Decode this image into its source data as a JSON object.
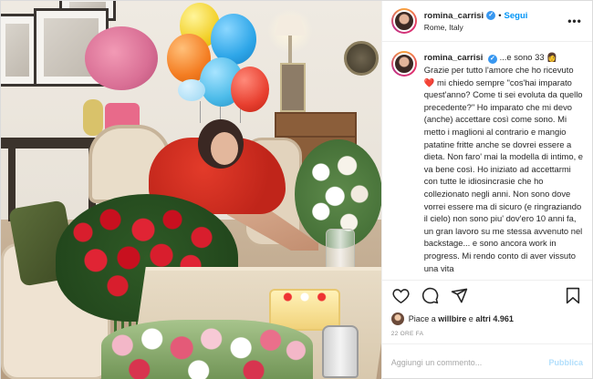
{
  "header": {
    "username": "romina_carrisi",
    "separator": "•",
    "follow_label": "Segui",
    "location": "Rome, Italy",
    "more_label": "•••"
  },
  "caption": {
    "username": "romina_carrisi",
    "title_line": "...e sono 33",
    "body_1": "Grazie per tutto l'amore che ho ricevuto",
    "body_2": " mi chiedo sempre \"cos'hai imparato quest'anno? Come ti sei evoluta da quello precedente?\" Ho imparato che mi devo (anche) accettare così come sono. Mi metto i maglioni al contrario e mangio patatine fritte anche se dovrei essere a dieta. Non faro' mai la modella di intimo, e va bene così. Ho iniziato ad accettarmi con tutte le idiosincrasie che ho collezionato negli anni. Non sono dove vorrei essere ma di sicuro (e ringraziando il cielo) non sono piu' dov'ero 10 anni fa, un gran lavoro su me stessa avvenuto nel backstage... e sono ancora work in progress. Mi rendo conto di aver vissuto una vita"
  },
  "likes": {
    "prefix": "Piace a",
    "user": "willbire",
    "middle": "e",
    "count": "altri 4.961"
  },
  "timestamp": "22 ORE FA",
  "comment": {
    "placeholder": "Aggiungi un commento...",
    "publish_label": "Pubblica"
  },
  "colors": {
    "accent": "#0095f6",
    "verified": "#3897f0",
    "publish_disabled": "#b2dffc",
    "heart": "#ed4956"
  },
  "icons": [
    "heart-icon",
    "comment-icon",
    "share-icon",
    "bookmark-icon",
    "verified-icon",
    "more-icon"
  ]
}
